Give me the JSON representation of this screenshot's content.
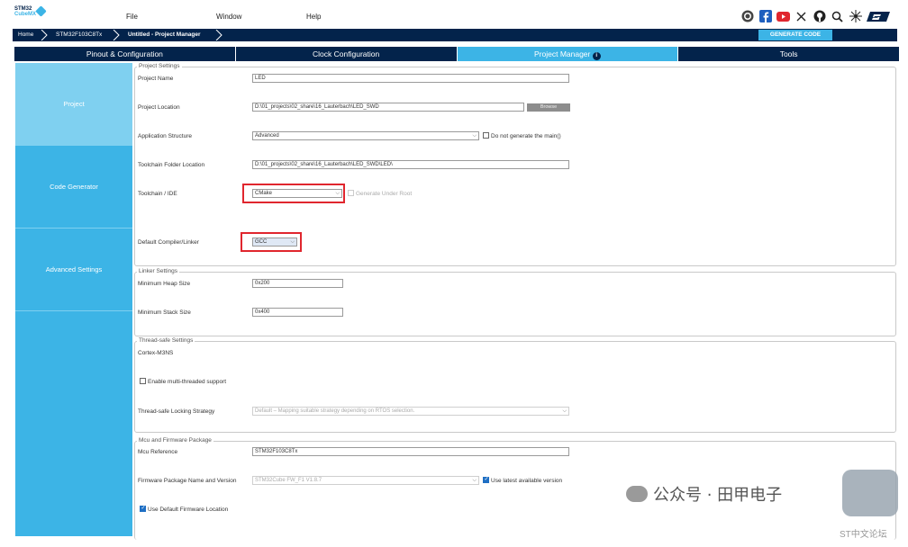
{
  "app": {
    "logo_line1": "STM32",
    "logo_line2": "CubeMX"
  },
  "menu": {
    "file": "File",
    "window": "Window",
    "help": "Help"
  },
  "top_icons": [
    "anniversary-icon",
    "facebook-icon",
    "youtube-icon",
    "x-icon",
    "github-icon",
    "search-icon",
    "network-icon",
    "st-logo-icon"
  ],
  "breadcrumb": {
    "home": "Home",
    "mcu": "STM32F103C8Tx",
    "project": "Untitled - Project Manager"
  },
  "generate_button": "GENERATE CODE",
  "tabs": [
    {
      "label": "Pinout & Configuration"
    },
    {
      "label": "Clock Configuration"
    },
    {
      "label": "Project Manager"
    },
    {
      "label": "Tools"
    }
  ],
  "tab_info_symbol": "i",
  "sidebar": {
    "items": [
      {
        "label": "Project"
      },
      {
        "label": "Code Generator"
      },
      {
        "label": "Advanced Settings"
      }
    ]
  },
  "project_settings": {
    "title": "Project Settings",
    "project_name_label": "Project Name",
    "project_name": "LED",
    "project_location_label": "Project Location",
    "project_location": "D:\\01_projects\\02_share\\16_Lauterbach\\LED_SWD",
    "browse_label": "Browse",
    "app_structure_label": "Application Structure",
    "app_structure": "Advanced",
    "no_main_label": "Do not generate the main()",
    "toolchain_folder_label": "Toolchain Folder Location",
    "toolchain_folder": "D:\\01_projects\\02_share\\16_Lauterbach\\LED_SWD\\LED\\",
    "toolchain_ide_label": "Toolchain / IDE",
    "toolchain_ide": "CMake",
    "generate_under_root_label": "Generate Under Root",
    "compiler_label": "Default Compiler/Linker",
    "compiler": "GCC"
  },
  "linker_settings": {
    "title": "Linker Settings",
    "heap_label": "Minimum Heap Size",
    "heap": "0x200",
    "stack_label": "Minimum Stack Size",
    "stack": "0x400"
  },
  "thread_settings": {
    "title": "Thread-safe Settings",
    "core": "Cortex-M3NS",
    "multithread_label": "Enable multi-threaded support",
    "locking_label": "Thread-safe Locking Strategy",
    "locking": "Default – Mapping suitable strategy depending on RTOS selection."
  },
  "mcu_settings": {
    "title": "Mcu and Firmware Package",
    "mcu_ref_label": "Mcu Reference",
    "mcu_ref": "STM32F103C8Tx",
    "fw_label": "Firmware Package Name and Version",
    "fw": "STM32Cube FW_F1 V1.8.7",
    "latest_label": "Use latest available version",
    "default_fw_label": "Use Default Firmware Location"
  },
  "watermark": {
    "text": "公众号 · 田甲电子",
    "forum": "ST中文论坛"
  },
  "colors": {
    "navy": "#03234b",
    "accent": "#3cb4e6",
    "highlight": "#e0262e"
  }
}
